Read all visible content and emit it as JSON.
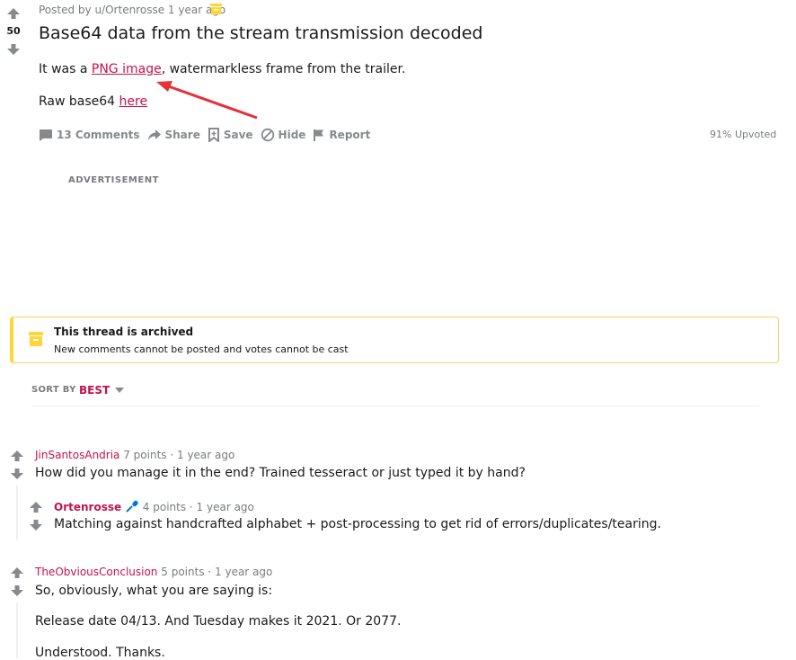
{
  "post": {
    "score": "50",
    "posted_by": "Posted by u/Ortenrosse",
    "age": "1 year ago",
    "title": "Base64 data from the stream transmission decoded",
    "body_prefix": "It was a ",
    "png_link": "PNG image",
    "body_suffix": ", watermarkless frame from the trailer.",
    "raw_prefix": "Raw base64 ",
    "here_link": "here",
    "annotation_arrow_color": "#e5313a"
  },
  "actions": {
    "comments": "13 Comments",
    "share": "Share",
    "save": "Save",
    "hide": "Hide",
    "report": "Report",
    "upvoted": "91% Upvoted"
  },
  "advertisement": "ADVERTISEMENT",
  "archived": {
    "title": "This thread is archived",
    "subtitle": "New comments cannot be posted and votes cannot be cast",
    "icon": "archive-icon"
  },
  "sort": {
    "label": "SORT BY",
    "value": "BEST"
  },
  "comments": [
    {
      "author": "JinSantosAndria",
      "points": "7 points",
      "age": "1 year ago",
      "body": "How did you manage it in the end? Trained tesseract or just typed it by hand?"
    },
    {
      "author": "Ortenrosse",
      "points": "4 points",
      "age": "1 year ago",
      "body": "Matching against handcrafted alphabet + post-processing to get rid of errors/duplicates/tearing."
    },
    {
      "author": "TheObviousConclusion",
      "points": "5 points",
      "age": "1 year ago",
      "body1": "So, obviously, what you are saying is:",
      "body2": "Release date 04/13. And Tuesday makes it 2021. Or 2077.",
      "body3": "Understood. Thanks."
    }
  ],
  "colors": {
    "accent": "#c4124f",
    "muted": "#878a8c",
    "archived_border": "#ffd635"
  }
}
